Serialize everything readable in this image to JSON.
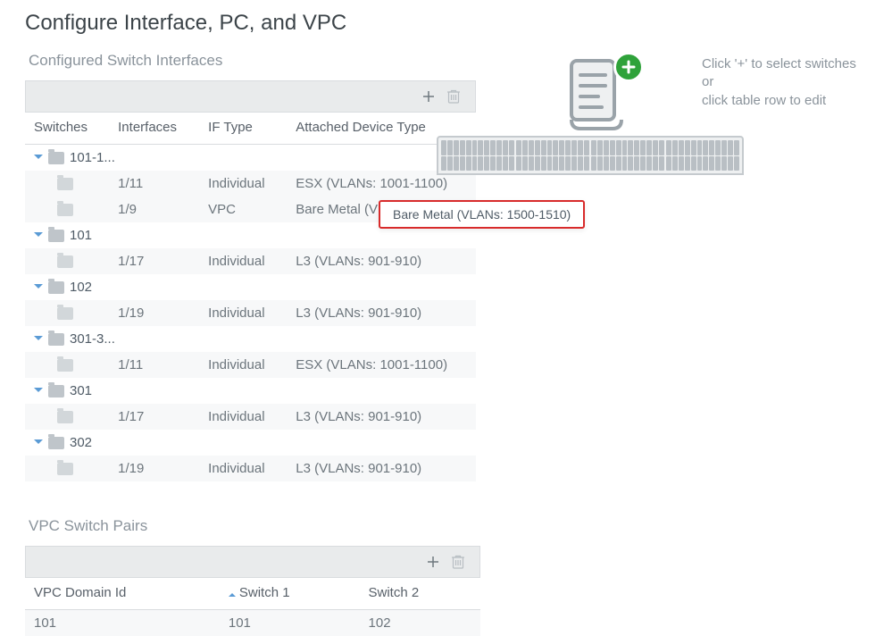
{
  "title": "Configure Interface, PC, and VPC",
  "sectionInterfaces": "Configured Switch Interfaces",
  "sectionVpc": "VPC Switch Pairs",
  "hint": {
    "line1": "Click '+' to select switches or",
    "line2": "click table row to edit"
  },
  "tooltip": "Bare Metal (VLANs: 1500-1510)",
  "ifTable": {
    "headers": {
      "switches": "Switches",
      "interfaces": "Interfaces",
      "iftype": "IF Type",
      "attached": "Attached Device Type"
    },
    "rows": [
      {
        "type": "group",
        "label": "101-1..."
      },
      {
        "type": "row",
        "interfaces": "1/11",
        "iftype": "Individual",
        "attached": "ESX (VLANs: 1001-1100)"
      },
      {
        "type": "row",
        "interfaces": "1/9",
        "iftype": "VPC",
        "attached": "Bare Metal (VLANs: 1500..."
      },
      {
        "type": "group",
        "label": "101"
      },
      {
        "type": "row",
        "interfaces": "1/17",
        "iftype": "Individual",
        "attached": "L3 (VLANs: 901-910)"
      },
      {
        "type": "group",
        "label": "102"
      },
      {
        "type": "row",
        "interfaces": "1/19",
        "iftype": "Individual",
        "attached": "L3 (VLANs: 901-910)"
      },
      {
        "type": "group",
        "label": "301-3..."
      },
      {
        "type": "row",
        "interfaces": "1/11",
        "iftype": "Individual",
        "attached": "ESX (VLANs: 1001-1100)"
      },
      {
        "type": "group",
        "label": "301"
      },
      {
        "type": "row",
        "interfaces": "1/17",
        "iftype": "Individual",
        "attached": "L3 (VLANs: 901-910)"
      },
      {
        "type": "group",
        "label": "302"
      },
      {
        "type": "row",
        "interfaces": "1/19",
        "iftype": "Individual",
        "attached": "L3 (VLANs: 901-910)"
      }
    ]
  },
  "vpcTable": {
    "headers": {
      "domain": "VPC Domain Id",
      "s1": "Switch 1",
      "s2": "Switch 2"
    },
    "rows": [
      {
        "domain": "101",
        "s1": "101",
        "s2": "102"
      }
    ]
  }
}
